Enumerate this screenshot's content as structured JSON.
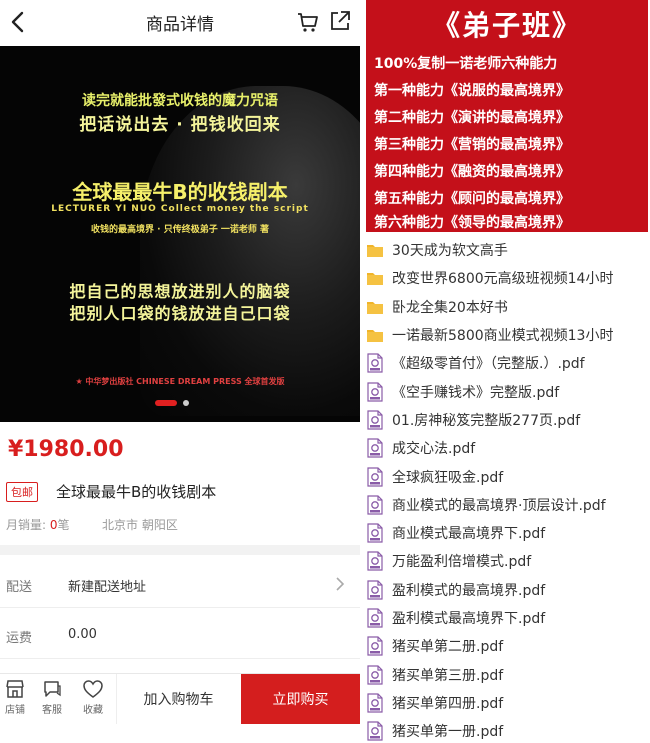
{
  "header": {
    "title": "商品详情"
  },
  "banner": {
    "line1": "读完就能批發式收钱的魔力咒语",
    "line2": "把话说出去 · 把钱收回来",
    "line3": "全球最最牛B的收钱剧本",
    "line4": "LECTURER YI NUO  Collect money the script",
    "line5": "收钱的最高境界 · 只传终极弟子        一诺老师 著",
    "line6": "把自己的思想放进别人的脑袋",
    "line7": "把别人口袋的钱放进自己口袋",
    "line8": "★ 中华梦出版社 CHINESE DREAM PRESS  全球首发版"
  },
  "product": {
    "price": "¥1980.00",
    "tag": "包邮",
    "name": "全球最最牛B的收钱剧本",
    "sales_label": "月销量: ",
    "sales_value": "0",
    "sales_unit": "笔",
    "location": "北京市 朝阳区"
  },
  "shipping": {
    "label": "配送",
    "value": "新建配送地址"
  },
  "freight": {
    "label": "运费",
    "value": "0.00"
  },
  "bottombar": {
    "store": "店铺",
    "service": "客服",
    "favorite": "收藏",
    "add_to_cart": "加入购物车",
    "buy_now": "立即购买"
  },
  "poster": {
    "title": "《弟子班》",
    "lines": [
      "100%复制一诺老师六种能力",
      "第一种能力《说服的最高境界》",
      "第二种能力《演讲的最高境界》",
      "第三种能力《营销的最高境界》",
      "第四种能力《融资的最高境界》",
      "第五种能力《顾问的最高境界》",
      "第六种能力《领导的最高境界》"
    ]
  },
  "files": [
    {
      "type": "folder",
      "name": "30天成为软文高手"
    },
    {
      "type": "folder",
      "name": "改变世界6800元高级班视频14小时"
    },
    {
      "type": "folder",
      "name": "卧龙全集20本好书"
    },
    {
      "type": "folder",
      "name": "一诺最新5800商业模式视频13小时"
    },
    {
      "type": "pdf",
      "name": "《超级零首付》（完整版.）.pdf"
    },
    {
      "type": "pdf",
      "name": "《空手赚钱术》完整版.pdf"
    },
    {
      "type": "pdf",
      "name": "01.房神秘笈完整版277页.pdf"
    },
    {
      "type": "pdf",
      "name": "成交心法.pdf"
    },
    {
      "type": "pdf",
      "name": "全球疯狂吸金.pdf"
    },
    {
      "type": "pdf",
      "name": "商业模式的最高境界·顶层设计.pdf"
    },
    {
      "type": "pdf",
      "name": "商业模式最高境界下.pdf"
    },
    {
      "type": "pdf",
      "name": "万能盈利倍增模式.pdf"
    },
    {
      "type": "pdf",
      "name": "盈利模式的最高境界.pdf"
    },
    {
      "type": "pdf",
      "name": "盈利模式最高境界下.pdf"
    },
    {
      "type": "pdf",
      "name": "猪买单第二册.pdf"
    },
    {
      "type": "pdf",
      "name": "猪买单第三册.pdf"
    },
    {
      "type": "pdf",
      "name": "猪买单第四册.pdf"
    },
    {
      "type": "pdf",
      "name": "猪买单第一册.pdf"
    }
  ],
  "colors": {
    "accent": "#d41e1e",
    "poster_bg": "#c4101a",
    "folder": "#f0b429"
  }
}
